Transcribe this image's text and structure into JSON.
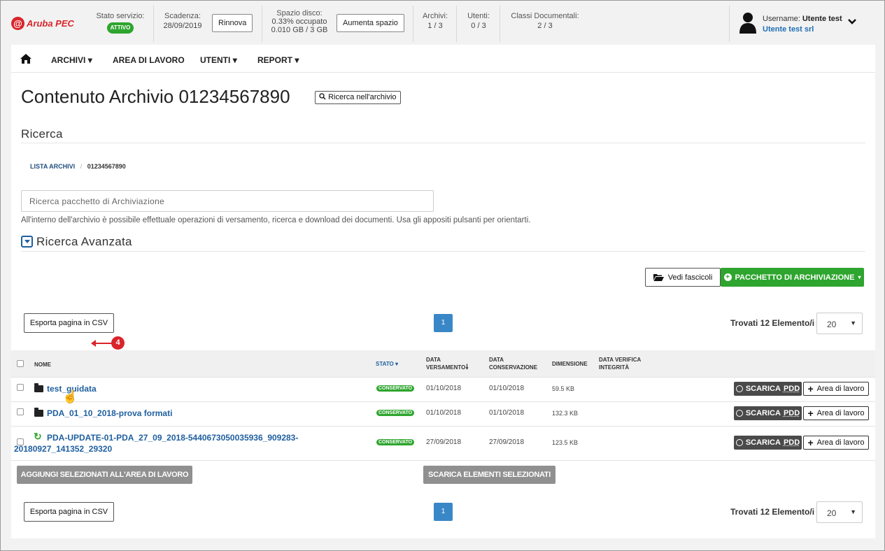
{
  "brand": {
    "logo_mark": "@",
    "logo_text": "Aruba PEC"
  },
  "topbar": {
    "stato_label": "Stato servizio:",
    "stato_badge": "ATTIVO",
    "scadenza_label": "Scadenza:",
    "scadenza_value": "28/09/2019",
    "rinnova_label": "Rinnova",
    "spazio_label": "Spazio disco:",
    "spazio_pct": "0.33% occupato",
    "spazio_value": "0.010 GB / 3 GB",
    "aumenta_label": "Aumenta spazio",
    "archivi_label": "Archivi:",
    "archivi_value": "1 / 3",
    "utenti_label": "Utenti:",
    "utenti_value": "0 / 3",
    "classi_label": "Classi Documentali:",
    "classi_value": "2 / 3",
    "username_label": "Username:",
    "username_value": "Utente test",
    "company": "Utente test srl",
    "icons": {
      "user": "user-silhouette-icon",
      "dropdown": "chevron-down-icon"
    }
  },
  "nav": {
    "items": [
      {
        "label": "ARCHIVI",
        "caret": "▾"
      },
      {
        "label": "AREA DI LAVORO",
        "caret": ""
      },
      {
        "label": "UTENTI",
        "caret": "▾"
      },
      {
        "label": "REPORT",
        "caret": "▾"
      }
    ],
    "home_icon": "home-icon"
  },
  "page": {
    "title": "Contenuto Archivio 01234567890",
    "search_archive_btn": "Ricerca nell'archivio",
    "section_title": "Ricerca",
    "breadcrumb": {
      "root": "LISTA ARCHIVI",
      "sep": "/",
      "current": "01234567890"
    },
    "search_placeholder": "Ricerca pacchetto di Archiviazione",
    "help_text": "All'interno dell'archivio è possibile effettuale operazioni di versamento, ricerca e download dei documenti. Usa gli appositi pulsanti per orientarti.",
    "advanced_title": "Ricerca Avanzata",
    "vedi_fascicoli": "Vedi fascicoli",
    "pacchetto_btn": "PACCHETTO DI ARCHIVIAZIONE",
    "csv_btn": "Esporta pagina in CSV",
    "page_number": "1",
    "found_text": "Trovati 12 Elemento/i",
    "page_size": "20"
  },
  "table": {
    "headers": {
      "nome": "NOME",
      "stato": "STATO",
      "data_versamento": [
        "DATA",
        "VERSAMENTO"
      ],
      "data_conservazione": [
        "DATA",
        "CONSERVAZIONE"
      ],
      "dimensione": "DIMENSIONE",
      "data_verifica": [
        "DATA VERIFICA",
        "INTEGRITÀ"
      ]
    },
    "rows": [
      {
        "icon": "folder-icon",
        "name": "test_guidata",
        "name_line2": "",
        "stato": "CONSERVATO",
        "versamento": "01/10/2018",
        "conservazione": "01/10/2018",
        "dimensione": "59.5 KB"
      },
      {
        "icon": "folder-icon",
        "name": "PDA_01_10_2018-prova formati",
        "name_line2": "",
        "stato": "CONSERVATO",
        "versamento": "01/10/2018",
        "conservazione": "01/10/2018",
        "dimensione": "132.3 KB"
      },
      {
        "icon": "refresh-icon",
        "name": "PDA-UPDATE-01-PDA_27_09_2018-5440673050035936_909283-",
        "name_line2": "20180927_141352_29320",
        "stato": "CONSERVATO",
        "versamento": "27/09/2018",
        "conservazione": "27/09/2018",
        "dimensione": "123.5 KB"
      }
    ],
    "scarica_label": "SCARICA",
    "scarica_pdd": "PDD",
    "area_label": "Area di lavoro"
  },
  "footer_actions": {
    "add_selected": "AGGIUNGI SELEZIONATI ALL'AREA DI LAVORO",
    "download_selected": "SCARICA ELEMENTI SELEZIONATI"
  },
  "annotation": {
    "callout_number": "4"
  }
}
